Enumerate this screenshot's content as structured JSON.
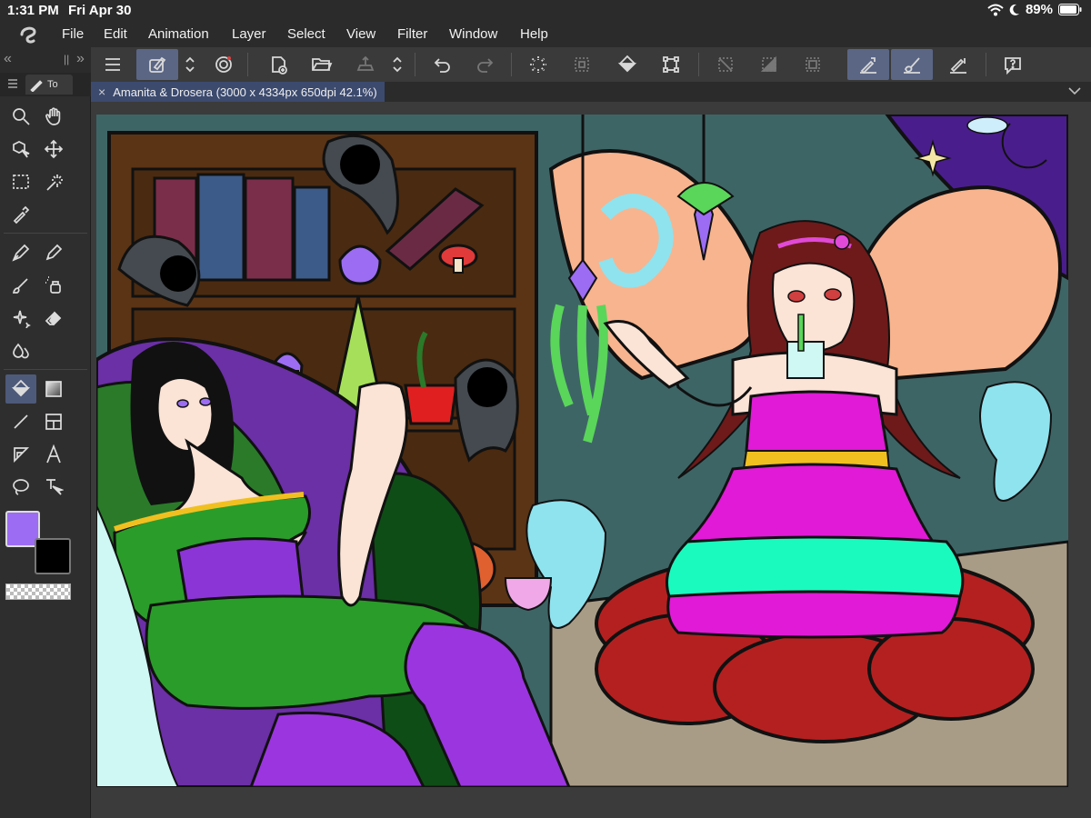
{
  "status_bar": {
    "time": "1:31 PM",
    "date": "Fri Apr 30",
    "battery": "89%"
  },
  "menu": {
    "items": [
      "File",
      "Edit",
      "Animation",
      "Layer",
      "Select",
      "View",
      "Filter",
      "Window",
      "Help"
    ]
  },
  "tool_tab": {
    "label": "To"
  },
  "document": {
    "tab_title": "Amanita & Drosera (3000 x 4334px 650dpi 42.1%)"
  },
  "colors": {
    "main_color": "#9c6cf3",
    "sub_color": "#000000",
    "accent": "#5b6685"
  },
  "icons": {
    "command_bar": [
      "menu-icon",
      "quick-access-icon",
      "up-down-icon",
      "spiral-icon",
      "new-canvas-icon",
      "open-folder-icon",
      "export-icon",
      "up-down-icon",
      "undo-icon",
      "redo-icon",
      "loading-icon",
      "selection-grid-icon",
      "fill-bucket-icon",
      "transform-icon",
      "clear-selection-icon",
      "gradient-fill-icon",
      "frame-icon",
      "pen-stabilizer-icon",
      "brush-stabilizer-icon",
      "ruler-snap-icon",
      "help-icon"
    ],
    "tools": [
      "zoom-icon",
      "hand-icon",
      "object-select-icon",
      "move-icon",
      "rectangle-select-icon",
      "auto-select-icon",
      "eyedropper-icon",
      "pen-icon",
      "pencil-icon",
      "brush-icon",
      "airbrush-icon",
      "decoration-icon",
      "eraser-icon",
      "blend-icon",
      "fill-icon",
      "gradient-icon",
      "line-icon",
      "frame-border-icon",
      "ruler-icon",
      "text-icon",
      "lasso-icon",
      "correct-line-icon"
    ]
  }
}
